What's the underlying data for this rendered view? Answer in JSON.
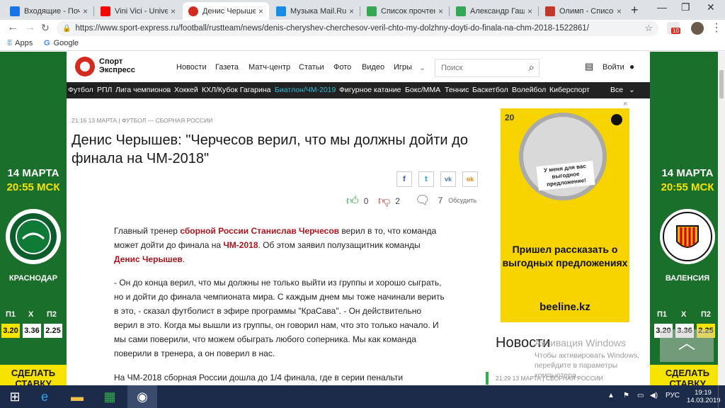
{
  "browser": {
    "tabs": [
      {
        "label": "Входящие - Почта",
        "favicon_color": "#1a73e8",
        "icon": "mail-icon"
      },
      {
        "label": "Vini Vici - Unive",
        "favicon_color": "#ff0000",
        "icon": "youtube-icon"
      },
      {
        "label": "Денис Черышев: \"Ч",
        "favicon_color": "#d52b1e",
        "icon": "sport-express-icon",
        "active": true
      },
      {
        "label": "Музыка Mail.Ru – с",
        "favicon_color": "#168de2",
        "icon": "mailru-icon"
      },
      {
        "label": "Список прочтений",
        "favicon_color": "#34a853",
        "icon": "sheets-icon"
      },
      {
        "label": "Александр Гашин",
        "favicon_color": "#34a853",
        "icon": "sheets-icon"
      },
      {
        "label": "Олимп - Список с",
        "favicon_color": "#c0392b",
        "icon": "olimp-icon"
      }
    ],
    "new_tab_glyph": "+",
    "url": "https://www.sport-express.ru/football/rustteam/news/denis-cheryshev-cherchesov-veril-chto-my-dolzhny-doyti-do-finala-na-chm-2018-1522861/",
    "bookmarks": [
      {
        "label": "Apps"
      },
      {
        "label": "Google"
      }
    ],
    "extension_badge": "10"
  },
  "site": {
    "logo_line1": "Спорт",
    "logo_line2": "Экспресс",
    "nav": [
      "Новости",
      "Газета",
      "Матч-центр",
      "Статьи",
      "Фото",
      "Видео",
      "Игры"
    ],
    "search_placeholder": "Поиск",
    "login": "Войти",
    "categories": [
      "Футбол",
      "РПЛ",
      "Лига чемпионов",
      "Хоккей",
      "КХЛ/Кубок Гагарина",
      "Биатлон/ЧМ-2019",
      "Фигурное катание",
      "Бокс/ММА",
      "Теннис",
      "Баскетбол",
      "Волейбол",
      "Киберспорт"
    ],
    "more": "Все"
  },
  "article": {
    "meta": "21:16 13 МАРТА | ФУТБОЛ — СБОРНАЯ РОССИИ",
    "title": "Денис Черышев: \"Черчесов верил, что мы должны дойти до финала на ЧМ-2018\"",
    "likes": "0",
    "dislikes": "2",
    "comments": "7",
    "discuss": "Обсудить",
    "share": [
      {
        "glyph": "f",
        "color": "#3b5998"
      },
      {
        "glyph": "t",
        "color": "#1da1f2"
      },
      {
        "glyph": "vk",
        "color": "#4c75a3"
      },
      {
        "glyph": "ok",
        "color": "#ee8208"
      }
    ],
    "p1_a": "Главный тренер ",
    "p1_link1": "сборной России Станислав Черчесов",
    "p1_b": " верил в то, что команда может дойти до финала на ",
    "p1_link2": "ЧМ-2018",
    "p1_c": ". Об этом заявил полузащитник команды ",
    "p1_link3": "Денис Черышев",
    "p1_d": ".",
    "p2": "- Он до конца верил, что мы должны не только выйти из группы и хорошо сыграть, но и дойти до финала чемпионата мира. С каждым днем мы тоже начинали верить в это, - сказал футболист в эфире программы \"КраСава\". - Он действительно верил в это. Когда мы вышли из группы, он говорил нам, что это только начало. И мы сами поверили, что можем обыграть любого соперника. Мы как команда поверили в тренера, а он поверил в нас.",
    "p3": "На ЧМ-2018 сборная России дошла до 1/4 финала, где в серии пенальти"
  },
  "ad": {
    "badge": "20",
    "note": "У меня для вас выгодное предложение!",
    "headline": "Пришел рассказать о выгодных предложениях",
    "url": "beeline.kz",
    "close": "×"
  },
  "sidebar_news": {
    "heading": "Новости",
    "meta": "21:29 13 МАРТА | СБОРНАЯ РОССИИ"
  },
  "promo": {
    "date": "14 МАРТА",
    "time": "20:55 МСК",
    "home_team": "КРАСНОДАР",
    "away_team": "ВАЛЕНСИЯ",
    "odds_labels": [
      "П1",
      "Х",
      "П2"
    ],
    "odds": [
      "3.20",
      "3.36",
      "2.25"
    ],
    "cta": "СДЕЛАТЬ СТАВКУ"
  },
  "windows": {
    "activation_title": "Активация Windows",
    "activation_text": "Чтобы активировать Windows, перейдите в параметры компьютера.",
    "lang": "РУС",
    "time": "19:19",
    "date": "14.03.2019"
  }
}
